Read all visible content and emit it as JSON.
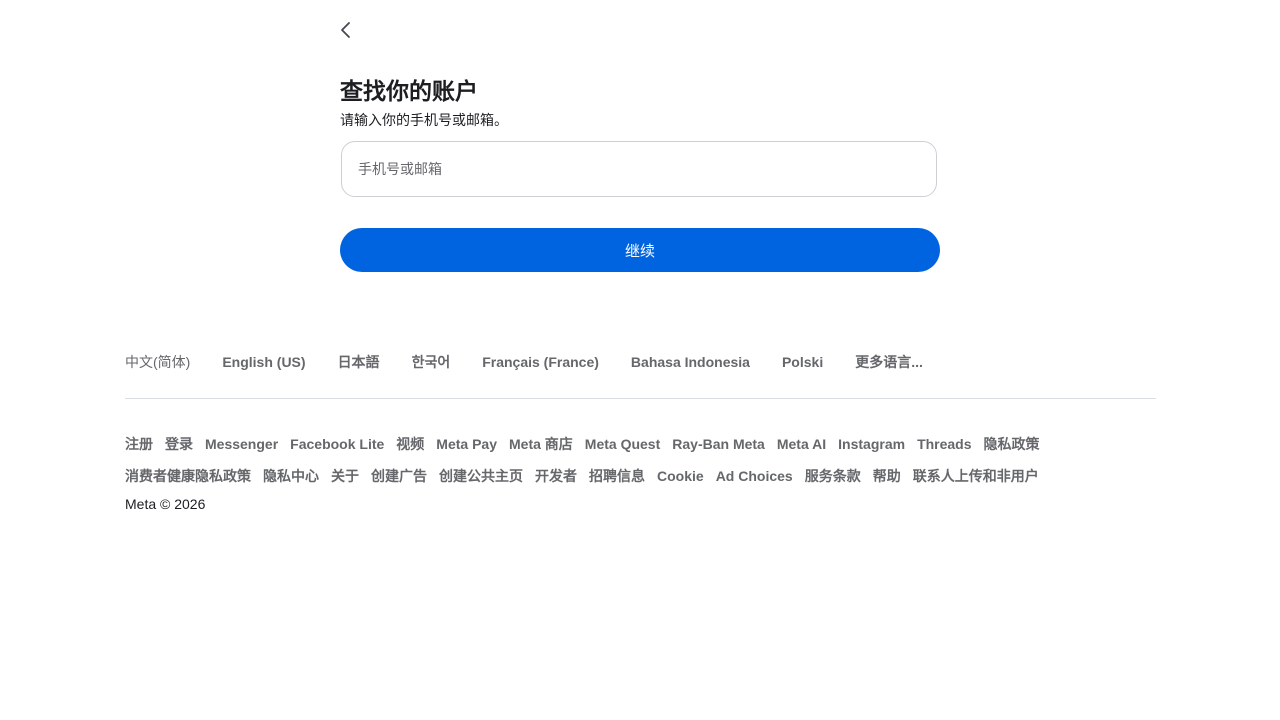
{
  "page": {
    "title": "查找你的账户",
    "subtitle": "请输入你的手机号或邮箱。"
  },
  "form": {
    "input_placeholder": "手机号或邮箱",
    "input_value": "",
    "continue_label": "继续"
  },
  "icons": {
    "back": "chevron-left-icon"
  },
  "colors": {
    "primary_button": "#0064e0",
    "link_text": "#65676b",
    "text": "#1c1e21"
  },
  "footer": {
    "languages": [
      {
        "label": "中文(简体)",
        "current": true
      },
      {
        "label": "English (US)"
      },
      {
        "label": "日本語"
      },
      {
        "label": "한국어"
      },
      {
        "label": "Français (France)"
      },
      {
        "label": "Bahasa Indonesia"
      },
      {
        "label": "Polski"
      },
      {
        "label": "更多语言..."
      }
    ],
    "links": [
      "注册",
      "登录",
      "Messenger",
      "Facebook Lite",
      "视频",
      "Meta Pay",
      "Meta 商店",
      "Meta Quest",
      "Ray-Ban Meta",
      "Meta AI",
      "Instagram",
      "Threads",
      "隐私政策",
      "消费者健康隐私政策",
      "隐私中心",
      "关于",
      "创建广告",
      "创建公共主页",
      "开发者",
      "招聘信息",
      "Cookie",
      "Ad Choices",
      "服务条款",
      "帮助",
      "联系人上传和非用户"
    ],
    "copyright": "Meta © 2026"
  }
}
